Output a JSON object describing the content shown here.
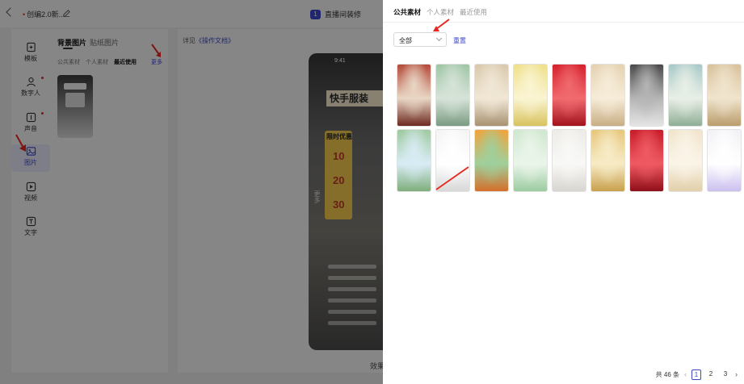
{
  "editor": {
    "doc_title": "创编2.0新...",
    "step_number": "1",
    "step_label": "直播间装修",
    "rail": [
      {
        "label": "模板",
        "icon": "template-icon"
      },
      {
        "label": "数字人",
        "icon": "avatar-icon"
      },
      {
        "label": "声音",
        "icon": "sound-icon"
      },
      {
        "label": "图片",
        "icon": "image-icon"
      },
      {
        "label": "视频",
        "icon": "video-icon"
      },
      {
        "label": "文字",
        "icon": "text-icon"
      }
    ],
    "asset_tabs": [
      "背景图片",
      "贴纸图片"
    ],
    "asset_subtabs": [
      "公共素材",
      "个人素材",
      "最近使用"
    ],
    "more_label": "更多",
    "doc_link_prefix": "详见",
    "doc_link_text": "《操作文档》",
    "phone": {
      "time": "9:41",
      "banner": "快手服装",
      "promo_title": "限时优惠",
      "numbers": [
        "10",
        "20",
        "30"
      ],
      "vertical_label": "更多"
    },
    "effect_label": "效果"
  },
  "drawer": {
    "tabs": [
      "公共素材",
      "个人素材",
      "最近使用"
    ],
    "filter_value": "全部",
    "reset_label": "重置",
    "images": [
      {
        "name": "red-lantern-room",
        "colors": [
          "#b44a3a",
          "#e9d6c4",
          "#6d2a22"
        ]
      },
      {
        "name": "green-mall-interior",
        "colors": [
          "#9fc6a6",
          "#d6e3d8",
          "#7a9b82"
        ]
      },
      {
        "name": "beige-showroom",
        "colors": [
          "#d9c9ad",
          "#f1e7d6",
          "#a89272"
        ]
      },
      {
        "name": "yellow-glow-room",
        "colors": [
          "#efe08a",
          "#faf4d2",
          "#d9c35e"
        ]
      },
      {
        "name": "red-arch",
        "colors": [
          "#d5222e",
          "#f06a6e",
          "#a3121d"
        ]
      },
      {
        "name": "cream-arch-hall",
        "colors": [
          "#e5d2b0",
          "#f6ecd9",
          "#c9ae84"
        ]
      },
      {
        "name": "dark-studio",
        "colors": [
          "#4a4a4a",
          "#b5b5b5",
          "#e4e4e4"
        ]
      },
      {
        "name": "garden-pavilion",
        "colors": [
          "#a8c9c9",
          "#e8efe6",
          "#8fae96"
        ]
      },
      {
        "name": "warm-living-room",
        "colors": [
          "#d9c29d",
          "#f0e4cd",
          "#b99d6c"
        ]
      },
      {
        "name": "green-hills",
        "colors": [
          "#9fc99f",
          "#d9ecf5",
          "#7fae7c"
        ]
      },
      {
        "name": "white-curve-stage",
        "colors": [
          "#f4f4f4",
          "#ffffff",
          "#d8d8d8"
        ]
      },
      {
        "name": "orange-shop-front",
        "colors": [
          "#f2a33c",
          "#9fcf9b",
          "#d46f2a"
        ]
      },
      {
        "name": "mint-platform",
        "colors": [
          "#cfe7cf",
          "#eaf5ea",
          "#9ccb9f"
        ]
      },
      {
        "name": "pale-wall-room",
        "colors": [
          "#ecebe7",
          "#f8f8f6",
          "#d8d6cf"
        ]
      },
      {
        "name": "golden-staircase",
        "colors": [
          "#e6c77c",
          "#f7ebc6",
          "#c8a04d"
        ]
      },
      {
        "name": "red-carpet-stage",
        "colors": [
          "#c71d2a",
          "#ef5a62",
          "#8f0e19"
        ]
      },
      {
        "name": "cream-gradient",
        "colors": [
          "#f1e4cc",
          "#faf4e8",
          "#e2cfaa"
        ]
      },
      {
        "name": "lavender-stripe",
        "colors": [
          "#f2f2f6",
          "#ffffff",
          "#cbbfee"
        ]
      }
    ],
    "pager": {
      "total": "共 46 条",
      "pages": [
        "1",
        "2",
        "3"
      ],
      "current": "1"
    }
  }
}
